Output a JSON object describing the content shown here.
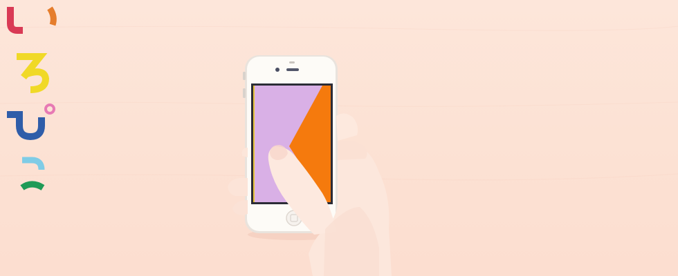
{
  "scene": {
    "description_colors": {
      "background": "#fde4d8",
      "phone_body": "#fdfbf7",
      "screen_left": "#d9b0e6",
      "screen_right": "#f57a0d"
    }
  },
  "logo": {
    "text": "いろぴっ",
    "colors": {
      "i_main": "#d93a55",
      "i_dot": "#e57d2c",
      "ro": "#f0d927",
      "pi_stroke": "#2f5da9",
      "pi_circle": "#e77ab4",
      "tsu_top": "#7fcce6",
      "tsu_bottom": "#1f9a56"
    }
  }
}
